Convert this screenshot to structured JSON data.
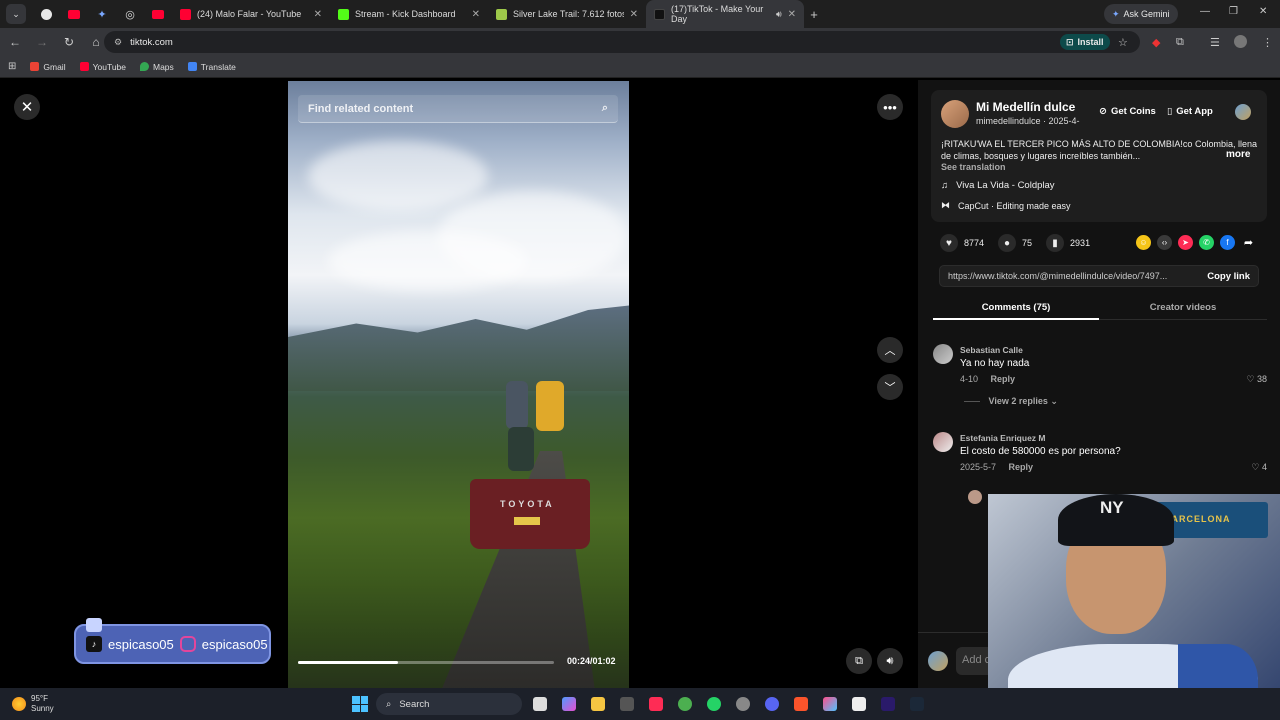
{
  "browser": {
    "tabs": [
      {
        "label": "",
        "color": "#ffffff",
        "pinned": true
      },
      {
        "label": "",
        "color": "#ff0033",
        "pinned": true
      },
      {
        "label": "",
        "color": "#4f8df7",
        "pinned": true
      },
      {
        "label": "",
        "color": "#dddddd",
        "pinned": true
      },
      {
        "label": "",
        "color": "#ff0033",
        "pinned": true
      },
      {
        "label": "(24) Malo Falar - YouTube",
        "color": "#ff0033"
      },
      {
        "label": "Stream - Kick Dashboard",
        "color": "#53fc18"
      },
      {
        "label": "Silver Lake Trail: 7.612 fotos - U",
        "color": "#9ec94a"
      },
      {
        "label": "(17)TikTok - Make Your Day",
        "color": "#111111",
        "active": true
      }
    ],
    "ask_gemini": "Ask Gemini",
    "url": "tiktok.com",
    "install_label": "Install",
    "bookmarks": [
      {
        "label": "Gmail",
        "color": "#ea4335"
      },
      {
        "label": "YouTube",
        "color": "#ff0033"
      },
      {
        "label": "Maps",
        "color": "#34a853"
      },
      {
        "label": "Translate",
        "color": "#4285f4"
      }
    ]
  },
  "video": {
    "search_placeholder": "Find related content",
    "truck_brand": "TOYOTA",
    "progress_fraction": 0.39,
    "timecode": "00:24/01:02"
  },
  "overlay": {
    "tiktok_handle": "espicaso05",
    "instagram_handle": "espicaso05"
  },
  "post": {
    "author": "Mi Medellín dulce",
    "author_sub": "mimedellindulce · 2025-4-",
    "get_coins": "Get Coins",
    "get_app": "Get App",
    "description": "¡RITAKU'WA EL TERCER PICO MÁS ALTO DE COLOMBIA!co Colombia, llena de climas, bosques y lugares increíbles también...",
    "more": "more",
    "see_translation": "See translation",
    "music": "Viva La Vida - Coldplay",
    "capcut": "CapCut · Editing made easy",
    "likes": "8774",
    "comments": "75",
    "saves": "2931",
    "link": "https://www.tiktok.com/@mimedellindulce/video/7497...",
    "copy_link": "Copy link",
    "tab_comments": "Comments (75)",
    "tab_creator": "Creator videos"
  },
  "comments": [
    {
      "user": "Sebastian Calle",
      "text": "Ya no hay nada",
      "date": "4-10",
      "reply": "Reply",
      "likes": "38",
      "view_replies": "View 2 replies"
    },
    {
      "user": "Estefania Enriquez M",
      "text": "El costo de 580000 es por persona?",
      "date": "2025-5-7",
      "reply": "Reply",
      "likes": "4"
    }
  ],
  "comment_bar": {
    "placeholder": "Add c"
  },
  "webcam": {
    "banner": "FCBARCELONA"
  },
  "taskbar": {
    "temperature": "95°F",
    "condition": "Sunny",
    "search": "Search"
  }
}
